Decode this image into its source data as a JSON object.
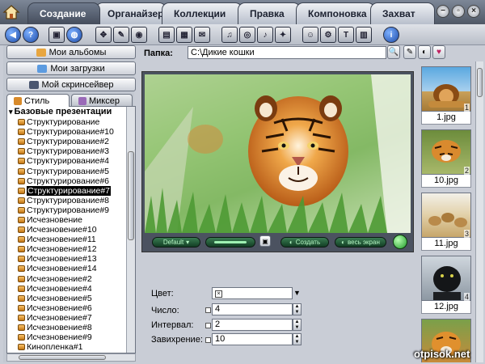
{
  "tabs": [
    "Создание",
    "Органайзер",
    "Коллекции",
    "Правка",
    "Компоновка",
    "Захват"
  ],
  "left_panel": {
    "nav_buttons": [
      "Мои альбомы",
      "Мои загрузки",
      "Мой скринсейвер"
    ],
    "tabs": [
      "Стиль",
      "Миксер"
    ],
    "list_header": "Базовые презентации",
    "items": [
      "Структурирование",
      "Структурирование#10",
      "Структурирование#2",
      "Структурирование#3",
      "Структурирование#4",
      "Структурирование#5",
      "Структурирование#6",
      "Структурирование#7",
      "Структурирование#8",
      "Структурирование#9",
      "Исчезновение",
      "Исчезновение#10",
      "Исчезновение#11",
      "Исчезновение#12",
      "Исчезновение#13",
      "Исчезновение#14",
      "Исчезновение#2",
      "Исчезновение#4",
      "Исчезновение#5",
      "Исчезновение#6",
      "Исчезновение#7",
      "Исчезновение#8",
      "Исчезновение#9",
      "Кинопленка#1"
    ],
    "selected": "Структурирование#7"
  },
  "folder": {
    "label": "Папка:",
    "value": "C:\\Дикие кошки"
  },
  "preview": {
    "default_label": "Default",
    "create_label": "Создать",
    "fullscreen_label": "весь экран"
  },
  "form": {
    "color_label": "Цвет:",
    "count_label": "Число:",
    "count_value": "4",
    "interval_label": "Интервал:",
    "interval_value": "2",
    "swirl_label": "Завихрение:",
    "swirl_value": "10"
  },
  "thumbnails": [
    {
      "file": "1.jpg",
      "num": "1"
    },
    {
      "file": "10.jpg",
      "num": "2"
    },
    {
      "file": "11.jpg",
      "num": "3"
    },
    {
      "file": "12.jpg",
      "num": "4"
    }
  ],
  "watermark": "otpisok.net",
  "colors": {
    "selection": "#000000",
    "accent_green": "#2f7a48",
    "tab_active": "#5a6576"
  }
}
